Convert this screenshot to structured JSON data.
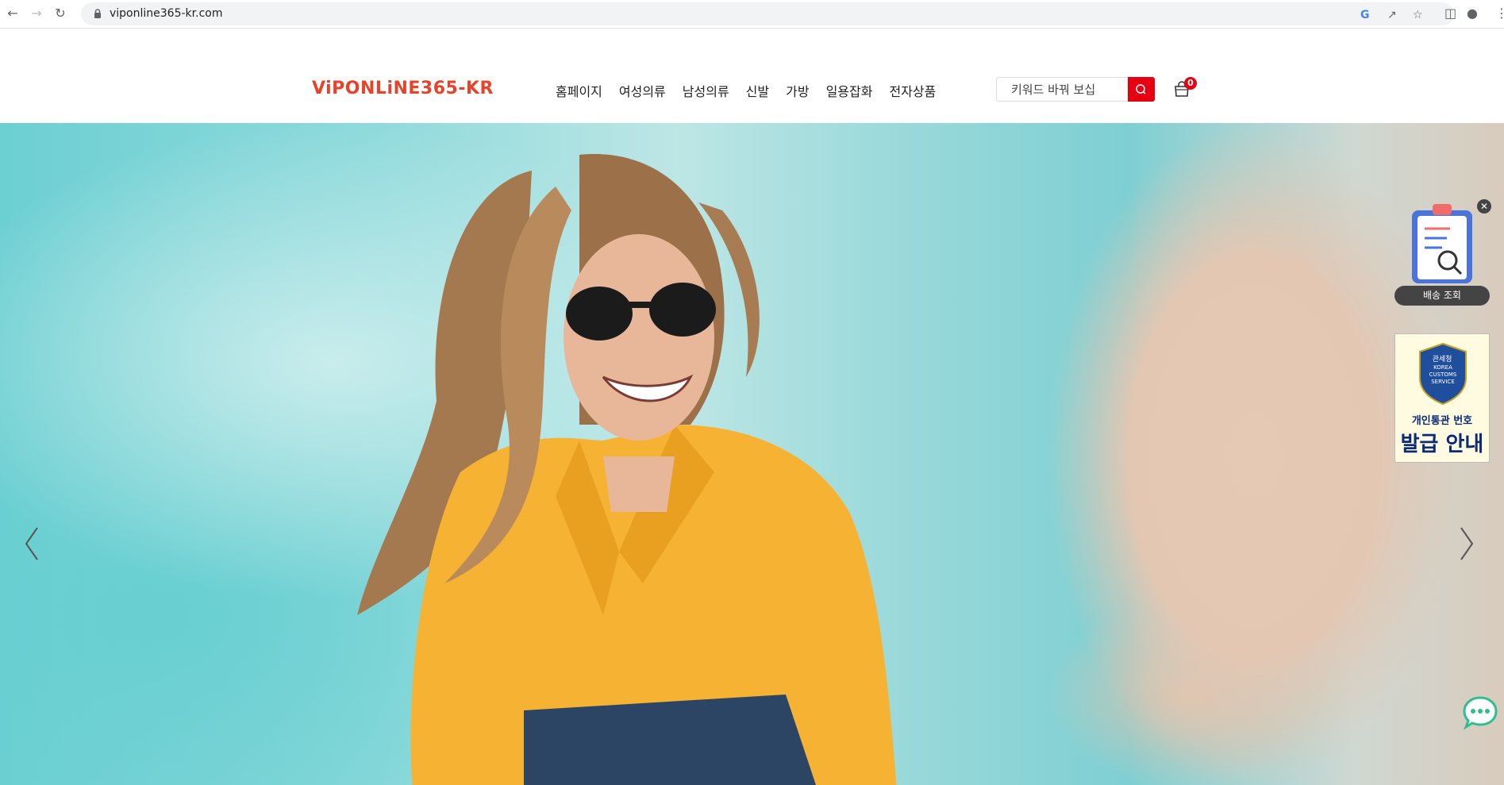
{
  "browser": {
    "url": "viponline365-kr.com"
  },
  "site": {
    "logo": "ViPONLiNE365-KR",
    "nav": [
      "홈페이지",
      "여성의류",
      "남성의류",
      "신발",
      "가방",
      "일용잡화",
      "전자상품"
    ],
    "search_placeholder": "키워드 바꿔 보십",
    "cart_count": "0"
  },
  "widgets": {
    "tracking_label": "배송 조회",
    "customs_top": "관세청",
    "customs_org": "KOREA CUSTOMS SERVICE",
    "customs_line1": "개인통관 번호",
    "customs_line2": "발급 안내"
  },
  "icons": {
    "back": "arrow-left-icon",
    "forward": "arrow-right-icon",
    "reload": "reload-icon",
    "lock": "lock-icon",
    "search": "search-icon",
    "cart": "shopping-bag-icon",
    "chat": "chat-bubble-icon"
  },
  "colors": {
    "brand": "#e8432a",
    "accent": "#e60012"
  }
}
